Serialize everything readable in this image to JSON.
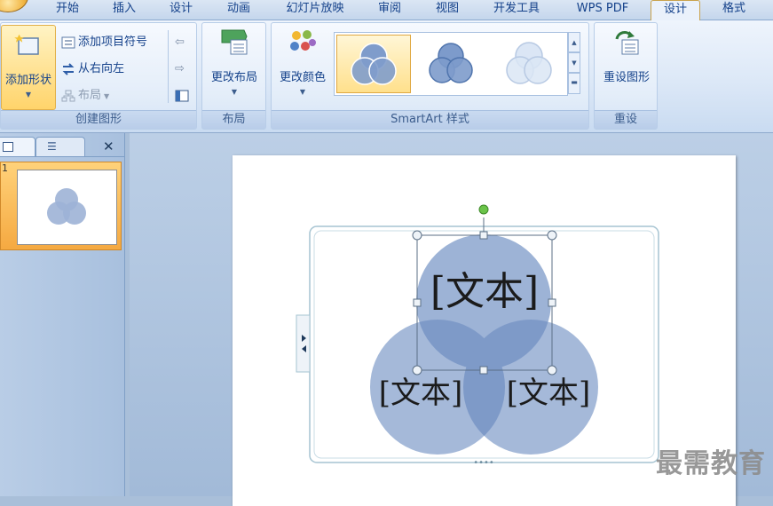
{
  "tabs": [
    {
      "id": "home",
      "label": "开始"
    },
    {
      "id": "insert",
      "label": "插入"
    },
    {
      "id": "design",
      "label": "设计"
    },
    {
      "id": "animation",
      "label": "动画"
    },
    {
      "id": "slideshow",
      "label": "幻灯片放映"
    },
    {
      "id": "review",
      "label": "审阅"
    },
    {
      "id": "view",
      "label": "视图"
    },
    {
      "id": "developer",
      "label": "开发工具"
    },
    {
      "id": "wps",
      "label": "WPS PDF"
    },
    {
      "id": "smartart_design",
      "label": "设计"
    },
    {
      "id": "smartart_format",
      "label": "格式"
    }
  ],
  "ribbon": {
    "create_graphic": {
      "title": "创建图形",
      "add_shape": "添加形状",
      "add_bullet": "添加项目符号",
      "right_to_left": "从右向左",
      "layout": "布局"
    },
    "layouts": {
      "title": "布局",
      "change_layout": "更改布局"
    },
    "styles": {
      "title": "SmartArt 样式",
      "change_colors": "更改颜色"
    },
    "reset": {
      "title": "重设",
      "reset_graphic": "重设图形"
    }
  },
  "slides_panel": {
    "slide_number": "1"
  },
  "diagram": {
    "top_text": "[文本]",
    "left_text": "[文本]",
    "right_text": "[文本]"
  },
  "colors": {
    "circle_fill": "#9db3d6",
    "circle_overlap": "#7e9ac8",
    "accent_tab": "#c9a24c"
  },
  "watermark": "最需教育"
}
